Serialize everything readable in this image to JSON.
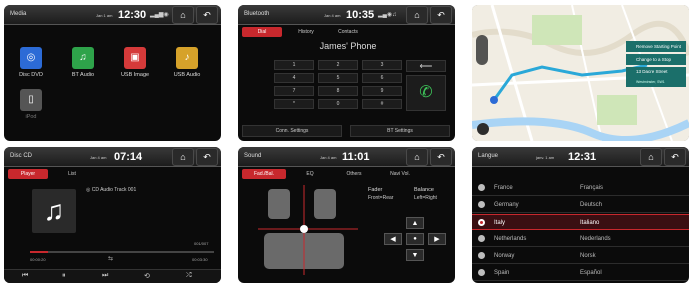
{
  "media": {
    "title": "Media",
    "date": "Jan 1 am",
    "time": "12:30",
    "home_icon": "home-icon",
    "back_icon": "back-icon",
    "items": [
      {
        "label": "Disc DVD",
        "color": "#2c6bd6",
        "icon": "disc-icon"
      },
      {
        "label": "BT Audio",
        "color": "#2ea34a",
        "icon": "bluetooth-icon"
      },
      {
        "label": "USB Image",
        "color": "#d53a3a",
        "icon": "usb-image-icon"
      },
      {
        "label": "USB Audio",
        "color": "#d6a22a",
        "icon": "usb-audio-icon"
      },
      {
        "label": "iPod",
        "color": "#555555",
        "icon": "ipod-icon"
      }
    ]
  },
  "bluetooth": {
    "title": "Bluetooth",
    "date": "Jan 4 am",
    "time": "10:35",
    "tabs": [
      "Dial",
      "History",
      "Contacts"
    ],
    "active_tab": "Dial",
    "display": "James' Phone",
    "keys": [
      "1",
      "2",
      "3",
      "4",
      "5",
      "6",
      "7",
      "8",
      "9",
      "*",
      "0",
      "#"
    ],
    "buttons": [
      "Conn. Settings",
      "BT Settings"
    ]
  },
  "disccd": {
    "title": "Disc CD",
    "date": "Jan 4 am",
    "time": "07:14",
    "tabs": [
      "Player",
      "List"
    ],
    "active_tab": "Player",
    "track": "CD Audio Track 001",
    "track_no": "001/007",
    "elapsed": "00:00:20",
    "total": "00:03:30",
    "progress": 0.1
  },
  "sound": {
    "title": "Sound",
    "date": "Jan 4 am",
    "time": "11:01",
    "tabs": [
      "Fad./Bal.",
      "EQ",
      "Others",
      "Navi Vol."
    ],
    "active_tab": "Fad./Bal.",
    "fader_label": "Fader",
    "fader_value": "Front=Rear",
    "balance_label": "Balance",
    "balance_value": "Left=Right"
  },
  "map": {
    "menu": [
      "Remove Starting Point",
      "Change to a Stop",
      "13 Dacre Street"
    ],
    "sub": "Westminster, SW1"
  },
  "langue": {
    "title": "Langue",
    "date": "janv. 1 am",
    "time": "12:31",
    "rows": [
      {
        "name": "France",
        "native": "Français",
        "selected": false
      },
      {
        "name": "Germany",
        "native": "Deutsch",
        "selected": false
      },
      {
        "name": "Italy",
        "native": "Italiano",
        "selected": true
      },
      {
        "name": "Netherlands",
        "native": "Nederlands",
        "selected": false
      },
      {
        "name": "Norway",
        "native": "Norsk",
        "selected": false
      },
      {
        "name": "Spain",
        "native": "Español",
        "selected": false
      }
    ]
  },
  "colors": {
    "accent": "#c8282d",
    "map_route": "#2aa8d8",
    "map_menu": "#1b6f6a"
  }
}
